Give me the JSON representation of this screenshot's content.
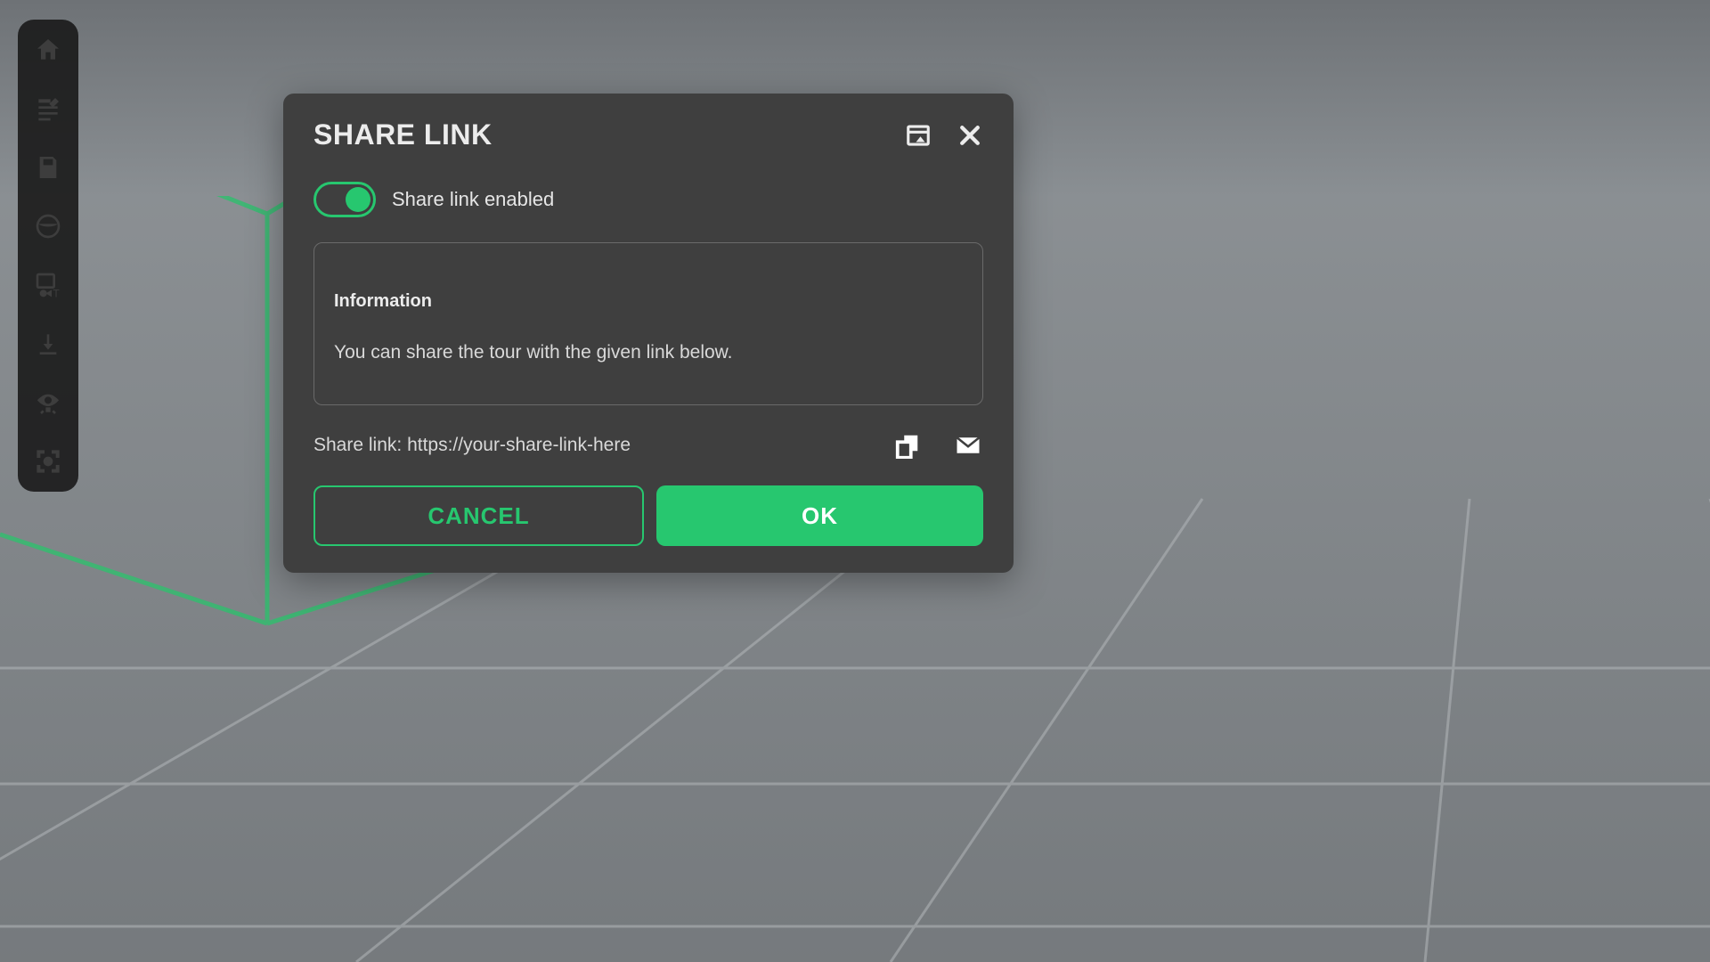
{
  "colors": {
    "accent": "#27c76f"
  },
  "sidebar": {
    "items": [
      {
        "name": "home-icon"
      },
      {
        "name": "edit-icon"
      },
      {
        "name": "save-icon"
      },
      {
        "name": "panorama-icon"
      },
      {
        "name": "media-icon"
      },
      {
        "name": "download-icon"
      },
      {
        "name": "view-icon"
      },
      {
        "name": "fullscreen-icon"
      }
    ]
  },
  "modal": {
    "title": "SHARE LINK",
    "header_actions": {
      "open_external": "open-external-icon",
      "close": "close-icon"
    },
    "toggle": {
      "enabled": true,
      "label": "Share link enabled"
    },
    "info": {
      "heading": "Information",
      "text": "You can share the tour with the given link below."
    },
    "share": {
      "label": "Share link:",
      "url": "https://your-share-link-here",
      "actions": {
        "copy": "copy-icon",
        "email": "email-icon"
      }
    },
    "buttons": {
      "cancel": "CANCEL",
      "ok": "OK"
    }
  }
}
